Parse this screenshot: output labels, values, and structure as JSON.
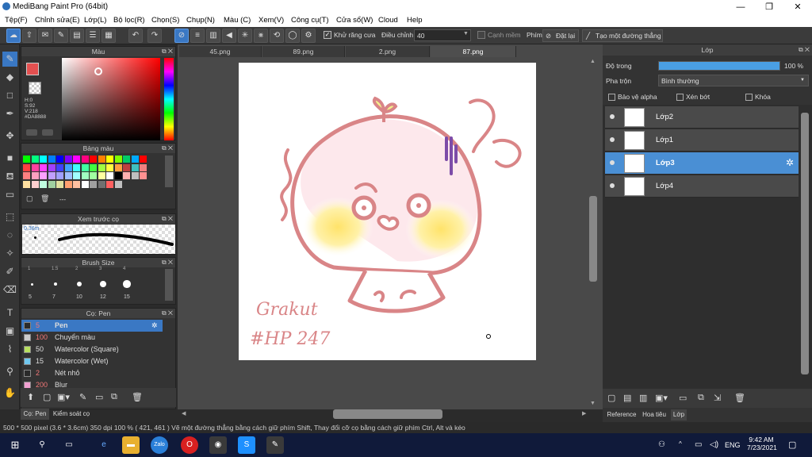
{
  "app": {
    "title": "MediBang Paint Pro (64bit)",
    "min": "—",
    "max": "❐",
    "close": "✕"
  },
  "menu": [
    "Tệp(F)",
    "Chỉnh sửa(E)",
    "Lớp(L)",
    "Bộ lọc(R)",
    "Chọn(S)",
    "Chụp(N)",
    "Màu (C)",
    "Xem(V)",
    "Công cụ(T)",
    "Cửa sổ(W)",
    "Cloud",
    "Help"
  ],
  "toolbar": {
    "antialias": "Khử răng cưa",
    "adjust_label": "Điều chỉnh",
    "adjust_value": "40",
    "edge": "Cạnh mềm",
    "keys": "Phím",
    "reset": "Đặt lại",
    "straight": "Tạo một đường thẳng"
  },
  "color_panel": {
    "title": "Màu",
    "h": "H:0",
    "s": "S:92",
    "v": "V:218",
    "hex": "#DA8888",
    "fg": "#e35050"
  },
  "palette_panel": {
    "title": "Bảng màu",
    "dash": "---"
  },
  "preview_panel": {
    "title": "Xem trước cọ",
    "size": "0.36m"
  },
  "brushsize_panel": {
    "title": "Brush Size",
    "top": [
      "1",
      "1.5",
      "2",
      "3",
      "4"
    ],
    "sizes": [
      "5",
      "7",
      "10",
      "12",
      "15"
    ]
  },
  "brush_panel": {
    "title": "Cọ: Pen",
    "items": [
      {
        "size": "5",
        "name": "Pen",
        "color": "#2a2a2a"
      },
      {
        "size": "100",
        "name": "Chuyển màu",
        "color": "#cccccc"
      },
      {
        "size": "50",
        "name": "Watercolor (Square)",
        "color": "#b8e060"
      },
      {
        "size": "15",
        "name": "Watercolor (Wet)",
        "color": "#70c8f0"
      },
      {
        "size": "2",
        "name": "Nét nhỏ",
        "color": "#2a2a2a"
      },
      {
        "size": "200",
        "name": "Blur",
        "color": "#f0a0d0"
      }
    ]
  },
  "bottom_tabs": {
    "pen": "Cọ: Pen",
    "control": "Kiểm soát cọ"
  },
  "tabs": [
    "45.png",
    "89.png",
    "2.png",
    "87.png"
  ],
  "layer_panel": {
    "title": "Lớp",
    "opacity_label": "Độ trong",
    "opacity_value": "100 %",
    "blend_label": "Pha trộn",
    "blend_value": "Bình thường",
    "protect_alpha": "Bảo vệ alpha",
    "clip": "Xén bớt",
    "lock": "Khóa",
    "opacity_fill": 1.0,
    "layers": [
      "Lớp2",
      "Lớp1",
      "Lớp3",
      "Lớp4"
    ],
    "bottom_tabs": [
      "Reference",
      "Hoa tiêu",
      "Lớp"
    ]
  },
  "canvas": {
    "sign1": "Grakut",
    "sign2": "#HP 247"
  },
  "status": "500 * 500 pixel   (3.6 * 3.6cm)   350 dpi   100 %   ( 421, 461 )   Vẽ một đường thẳng bằng cách giữ phím Shift, Thay đổi cỡ cọ bằng cách giữ phím Ctrl, Alt và kéo",
  "taskbar": {
    "lang": "ENG",
    "time": "9:42 AM",
    "date": "7/23/2021"
  }
}
